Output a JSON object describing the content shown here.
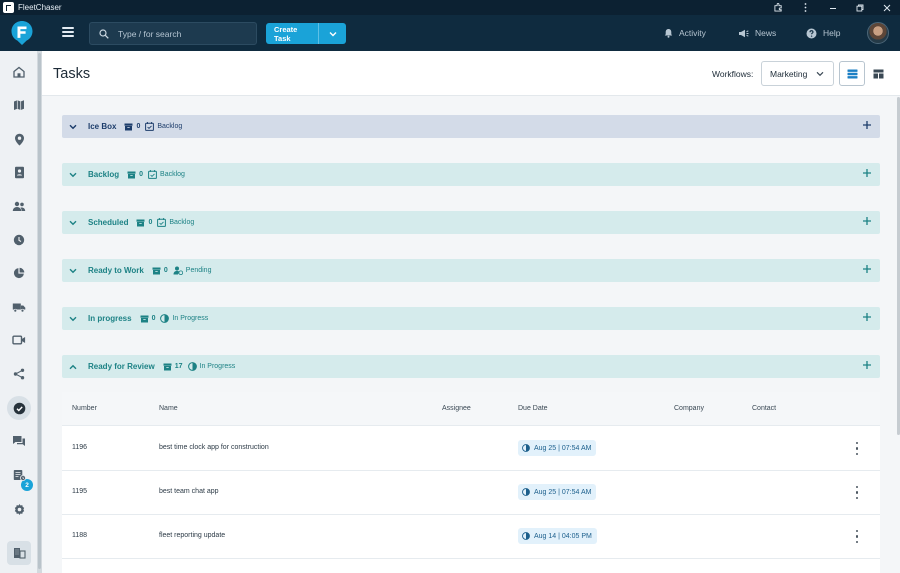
{
  "window": {
    "title": "FleetChaser",
    "controls": [
      "extension-icon",
      "more-vert-icon",
      "minimize-icon",
      "restore-icon",
      "close-icon"
    ]
  },
  "header": {
    "search_placeholder": "Type / for search",
    "create_label": "Create Task",
    "nav": [
      {
        "label": "Activity",
        "icon": "bell-icon"
      },
      {
        "label": "News",
        "icon": "megaphone-icon"
      },
      {
        "label": "Help",
        "icon": "help-icon"
      }
    ]
  },
  "sidebar": {
    "items": [
      "home-icon",
      "map-icon",
      "location-pin-icon",
      "contacts-book-icon",
      "users-icon",
      "clock-icon",
      "pie-chart-icon",
      "truck-icon",
      "video-icon",
      "share-icon",
      "tasks-check-icon",
      "chat-icon",
      "receipt-icon",
      "settings-icon",
      "building-icon"
    ],
    "active_item": "tasks-check-icon",
    "chat_badge": "2"
  },
  "page": {
    "title": "Tasks",
    "workflows_label": "Workflows:",
    "workflow_selected": "Marketing"
  },
  "groups": [
    {
      "name": "Ice Box",
      "count": "0",
      "status": "Backlog",
      "status_icon": "backlog-icon",
      "expanded": false,
      "theme": "ice"
    },
    {
      "name": "Backlog",
      "count": "0",
      "status": "Backlog",
      "status_icon": "backlog-icon",
      "expanded": false,
      "theme": "teal"
    },
    {
      "name": "Scheduled",
      "count": "0",
      "status": "Backlog",
      "status_icon": "backlog-icon",
      "expanded": false,
      "theme": "teal"
    },
    {
      "name": "Ready to Work",
      "count": "0",
      "status": "Pending",
      "status_icon": "pending-icon",
      "expanded": false,
      "theme": "teal"
    },
    {
      "name": "In progress",
      "count": "0",
      "status": "In Progress",
      "status_icon": "in-progress-icon",
      "expanded": false,
      "theme": "teal"
    },
    {
      "name": "Ready for Review",
      "count": "17",
      "status": "In Progress",
      "status_icon": "in-progress-icon",
      "expanded": true,
      "theme": "teal"
    }
  ],
  "table": {
    "columns": [
      "Number",
      "Name",
      "Assignee",
      "Due Date",
      "Company",
      "Contact"
    ],
    "rows": [
      {
        "number": "1196",
        "name": "best time clock app for construction",
        "assignee": "",
        "due": "Aug 25 | 07:54 AM",
        "company": "",
        "contact": ""
      },
      {
        "number": "1195",
        "name": "best team chat app",
        "assignee": "",
        "due": "Aug 25 | 07:54 AM",
        "company": "",
        "contact": ""
      },
      {
        "number": "1188",
        "name": "fleet reporting update",
        "assignee": "",
        "due": "Aug 14 | 04:05 PM",
        "company": "",
        "contact": ""
      }
    ]
  },
  "colors": {
    "header_bg": "#0f2b3f",
    "accent": "#1aa3d8",
    "teal_group": "#d5ebec",
    "ice_group": "#d3dbe8",
    "teal_text": "#1d8285"
  }
}
